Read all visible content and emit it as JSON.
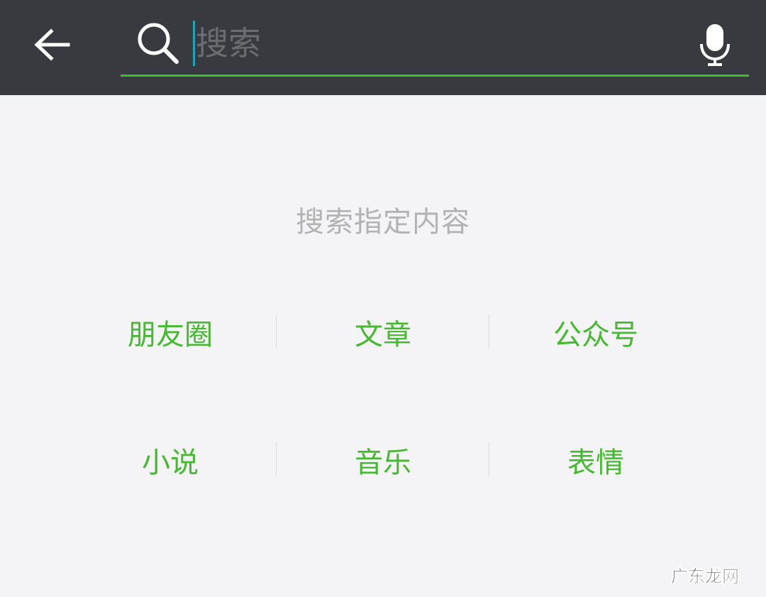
{
  "header": {
    "back_icon": "arrow-left-icon",
    "search": {
      "icon": "search-icon",
      "placeholder": "搜索",
      "value": ""
    },
    "voice_icon": "microphone-icon"
  },
  "main": {
    "hint": "搜索指定内容",
    "categories": [
      {
        "label": "朋友圈"
      },
      {
        "label": "文章"
      },
      {
        "label": "公众号"
      },
      {
        "label": "小说"
      },
      {
        "label": "音乐"
      },
      {
        "label": "表情"
      }
    ]
  },
  "watermark": "广东龙网",
  "colors": {
    "topbar_bg": "#393a3f",
    "accent_green": "#45b92f",
    "underline_green": "#3fbd2d",
    "cursor_teal": "#1aa7ba",
    "page_bg": "#f4f4f6",
    "hint_gray": "#b2b2b2"
  }
}
